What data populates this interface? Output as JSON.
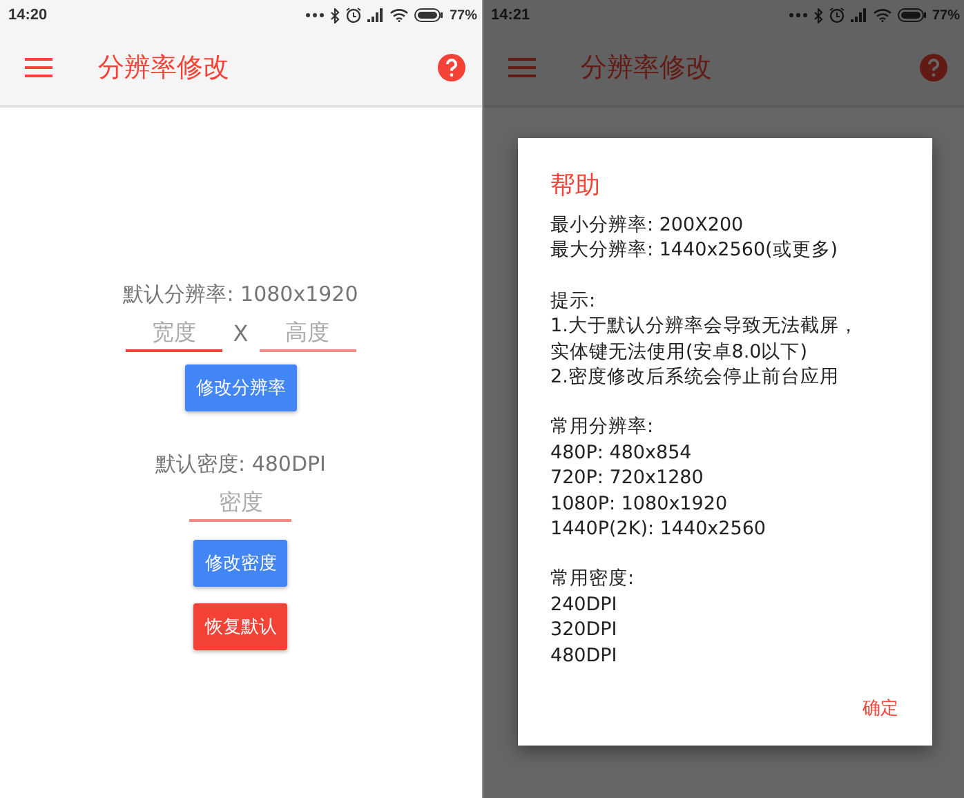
{
  "screens": [
    {
      "status_bar": {
        "time": "14:20",
        "battery": "77%"
      },
      "app_bar": {
        "title": "分辨率修改"
      },
      "dimmed": false,
      "main": {
        "resolution_label": "默认分辨率: 1080x1920",
        "width_field": {
          "placeholder": "宽度"
        },
        "separator": "X",
        "height_field": {
          "placeholder": "高度"
        },
        "resolution_button": "修改分辨率",
        "density_label": "默认密度: 480DPI",
        "density_field": {
          "placeholder": "密度"
        },
        "density_button": "修改密度",
        "reset_button": "恢复默认"
      }
    },
    {
      "status_bar": {
        "time": "14:21",
        "battery": "77%"
      },
      "app_bar": {
        "title": "分辨率修改"
      },
      "dimmed": true,
      "dialog": {
        "title": "帮助",
        "sections": [
          [
            "最小分辨率: 200X200",
            "最大分辨率: 1440x2560(或更多)"
          ],
          [
            "提示:",
            "1.大于默认分辨率会导致无法截屏，",
            "实体键无法使用(安卓8.0以下)",
            "2.密度修改后系统会停止前台应用"
          ],
          [
            "常用分辨率:",
            "480P: 480x854",
            "720P: 720x1280",
            "1080P: 1080x1920",
            "1440P(2K): 1440x2560"
          ],
          [
            "常用密度:",
            "240DPI",
            "320DPI",
            "480DPI"
          ]
        ],
        "ok_button": "确定"
      }
    }
  ]
}
